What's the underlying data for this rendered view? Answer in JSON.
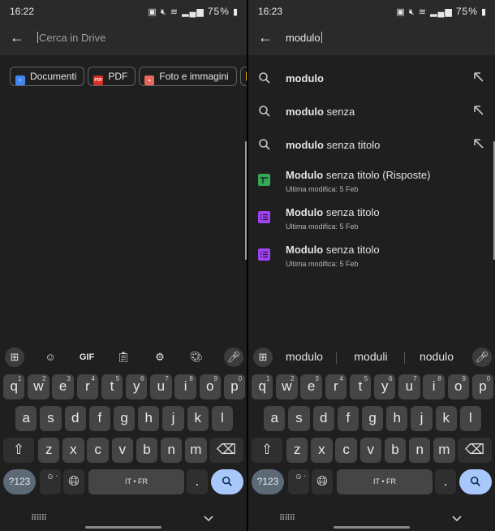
{
  "left": {
    "status": {
      "time": "16:22",
      "battery": "75%"
    },
    "search": {
      "placeholder": "Cerca in Drive"
    },
    "chips": [
      {
        "label": "Documenti",
        "icon": "docs-icon",
        "color": "#4285f4"
      },
      {
        "label": "PDF",
        "icon": "pdf-icon",
        "color": "#d93025"
      },
      {
        "label": "Foto e immagini",
        "icon": "image-icon",
        "color": "#e8685a"
      }
    ],
    "keyboard_suggestions_toolbar": [
      "apps-icon",
      "sticker-icon",
      "GIF",
      "clipboard-icon",
      "settings-icon",
      "palette-icon",
      "mic-icon"
    ]
  },
  "right": {
    "status": {
      "time": "16:23",
      "battery": "75%"
    },
    "search": {
      "value": "modulo"
    },
    "suggestions": [
      {
        "bold": "modulo",
        "rest": ""
      },
      {
        "bold": "modulo",
        "rest": " senza"
      },
      {
        "bold": "modulo",
        "rest": " senza titolo"
      }
    ],
    "files": [
      {
        "bold": "Modulo",
        "rest": " senza titolo (Risposte)",
        "meta": "Ultima modifica: 5 Feb",
        "icon": "sheets-icon",
        "color": "#34a853"
      },
      {
        "bold": "Modulo",
        "rest": " senza titolo",
        "meta": "Ultima modifica: 5 Feb",
        "icon": "forms-icon",
        "color": "#a142f4"
      },
      {
        "bold": "Modulo",
        "rest": " senza titolo",
        "meta": "Ultima modifica: 5 Feb",
        "icon": "forms-icon",
        "color": "#a142f4"
      }
    ],
    "predictions": [
      "modulo",
      "moduli",
      "nodulo"
    ]
  },
  "keyboard": {
    "row1": [
      {
        "k": "q",
        "s": "1"
      },
      {
        "k": "w",
        "s": "2"
      },
      {
        "k": "e",
        "s": "3"
      },
      {
        "k": "r",
        "s": "4"
      },
      {
        "k": "t",
        "s": "5"
      },
      {
        "k": "y",
        "s": "6"
      },
      {
        "k": "u",
        "s": "7"
      },
      {
        "k": "i",
        "s": "8"
      },
      {
        "k": "o",
        "s": "9"
      },
      {
        "k": "p",
        "s": "0"
      }
    ],
    "row2": [
      "a",
      "s",
      "d",
      "f",
      "g",
      "h",
      "j",
      "k",
      "l"
    ],
    "row3": [
      "z",
      "x",
      "c",
      "v",
      "b",
      "n",
      "m"
    ],
    "symbols_label": "?123",
    "emoji_label": "☺",
    "comma_label": ",",
    "space_label": "IT • FR",
    "period_label": ".",
    "shift_label": "⇧",
    "backspace_label": "⌫"
  },
  "colors": {
    "background": "#1f1f1f",
    "key": "#454545",
    "accent": "#a8c7fa",
    "fn_key": "#5c6a78"
  }
}
